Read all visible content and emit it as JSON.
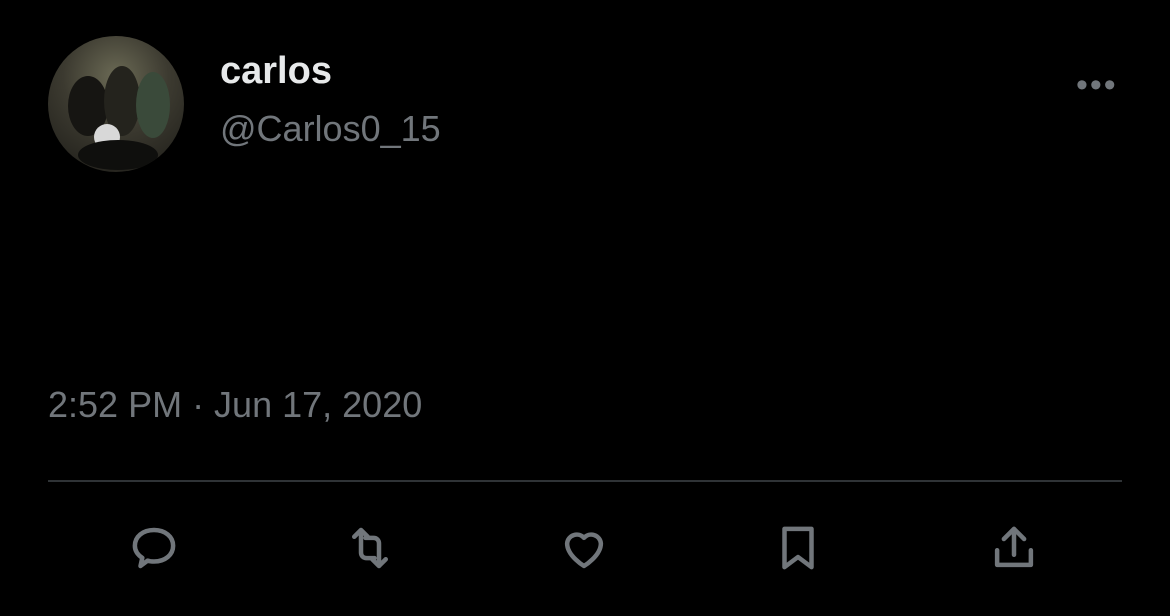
{
  "author": {
    "display_name": "carlos",
    "handle": "@Carlos0_15",
    "avatar_icon": "avatar-photo"
  },
  "menu": {
    "more_label": "•••"
  },
  "tweet": {
    "text": "",
    "timestamp": "2:52 PM · Jun 17, 2020"
  },
  "actions": [
    {
      "name": "reply",
      "icon": "reply-icon"
    },
    {
      "name": "retweet",
      "icon": "retweet-icon"
    },
    {
      "name": "like",
      "icon": "like-icon"
    },
    {
      "name": "bookmark",
      "icon": "bookmark-icon"
    },
    {
      "name": "share",
      "icon": "share-icon"
    }
  ],
  "colors": {
    "background": "#000000",
    "primary_text": "#e7e9ea",
    "secondary_text": "#71767b",
    "divider": "#2f3336"
  }
}
